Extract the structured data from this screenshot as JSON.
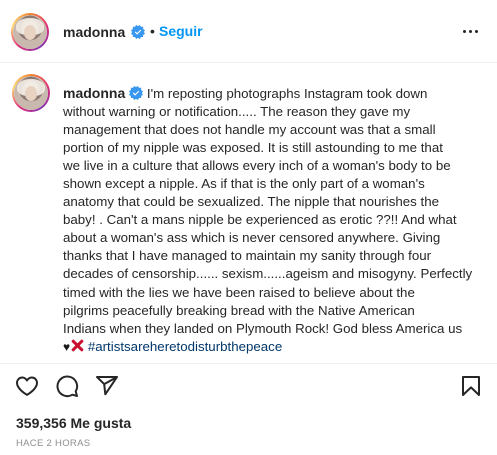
{
  "header": {
    "username": "madonna",
    "separator": "•",
    "follow_label": "Seguir"
  },
  "comment": {
    "username": "madonna",
    "caption_lines": [
      " I'm reposting photographs Instagram took down",
      "without warning or notification..... The reason they gave my",
      "management that does not handle my account was that a small",
      "portion of my nipple was exposed. It is still astounding to me that",
      "we live in a culture that allows every inch of a woman's body to be",
      "shown except a nipple. As if that is the only part of a woman's",
      "anatomy that could be sexualized. The nipple that nourishes the",
      "baby! . Can't a mans nipple be experienced as erotic ??!! And what",
      "about a woman's ass which is never censored anywhere. Giving",
      "thanks that I have managed to maintain my sanity through four",
      "decades of censorship...... sexism......ageism and misogyny. Perfectly",
      "timed with the lies we have been raised to believe about the",
      "pilgrims peacefully breaking bread with the Native American",
      "Indians when they landed on Plymouth Rock! God bless America us"
    ],
    "emoji_heart": "♥",
    "hashtag": "#artistsareheretodisturbthepeace"
  },
  "actions": {
    "icons": [
      "heart-icon",
      "comment-icon",
      "share-icon",
      "bookmark-icon"
    ]
  },
  "likes": {
    "text": "359,356 Me gusta"
  },
  "timestamp": "HACE 2 HORAS",
  "colors": {
    "text": "#262626",
    "link_blue": "#0095f6",
    "hashtag": "#00376b",
    "muted": "#8e8e8e",
    "divider": "#efefef"
  }
}
